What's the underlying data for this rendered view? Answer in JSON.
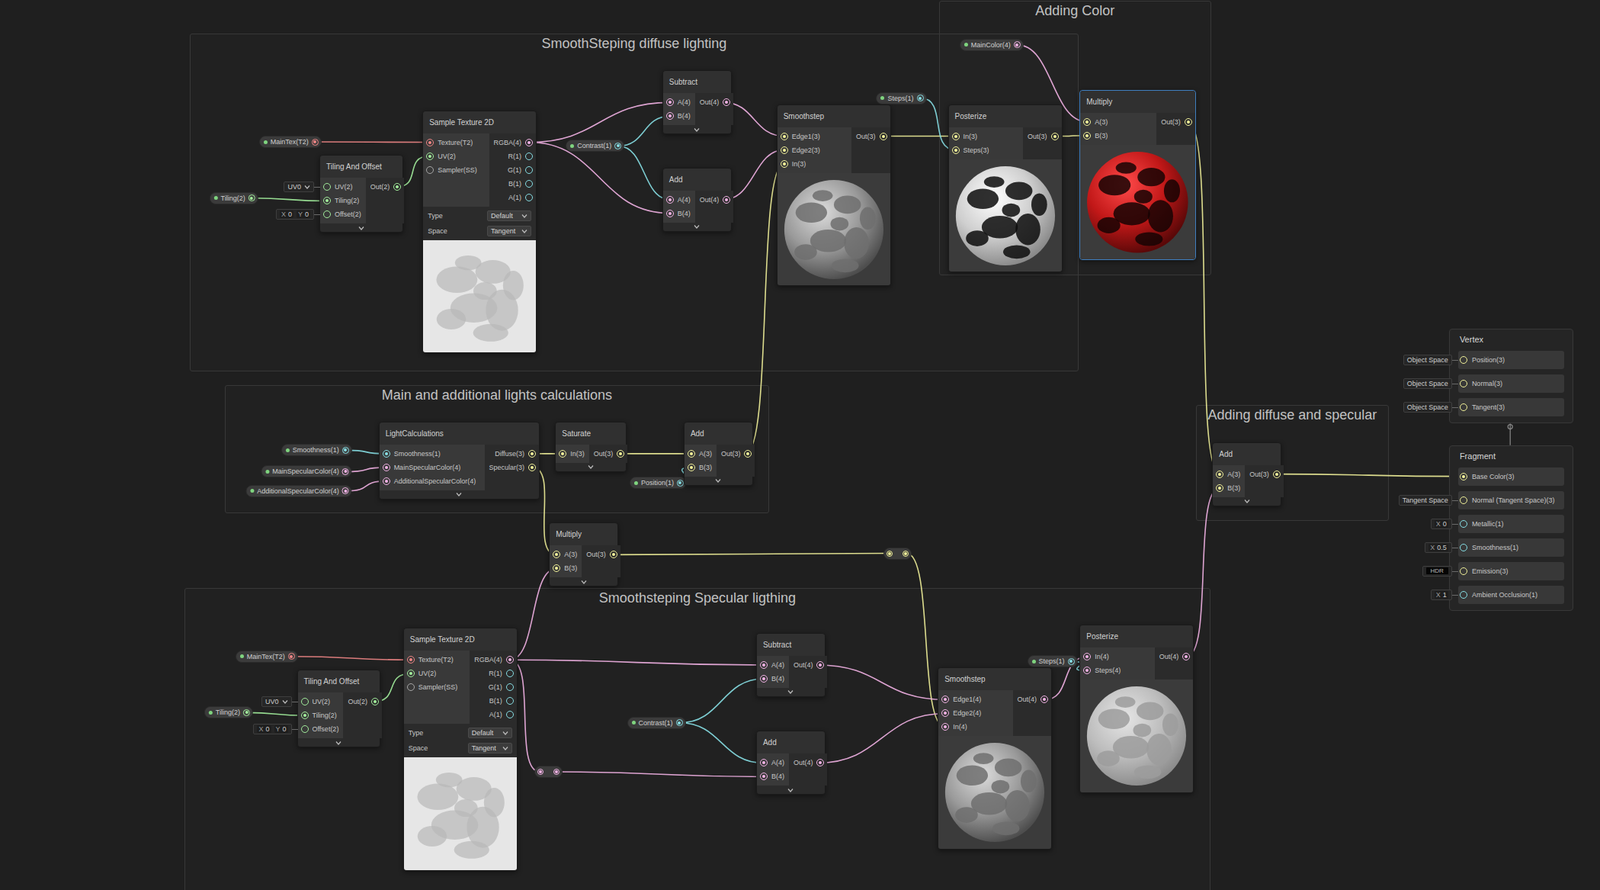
{
  "groups": [
    {
      "title": "SmoothSteping diffuse lighting"
    },
    {
      "title": "Adding Color"
    },
    {
      "title": "Main and additional lights calculations"
    },
    {
      "title": "Smoothsteping Specular ligthing"
    },
    {
      "title": "Adding diffuse and specular"
    }
  ],
  "properties": [
    {
      "label": "MainTex(T2)",
      "color": "#f08686"
    },
    {
      "label": "Tiling(2)",
      "color": "#a3ef9d"
    },
    {
      "label": "Contrast(1)",
      "color": "#87e0e6"
    },
    {
      "label": "Steps(1)",
      "color": "#87e0e6"
    },
    {
      "label": "MainColor(4)",
      "color": "#f3b3e6"
    },
    {
      "label": "Smoothness(1)",
      "color": "#87e0e6"
    },
    {
      "label": "MainSpecularColor(4)",
      "color": "#f3b3e6"
    },
    {
      "label": "AdditionalSpecularColor(4)",
      "color": "#f3b3e6"
    },
    {
      "label": "Position(1)",
      "color": "#87e0e6"
    },
    {
      "label": "MainTex(T2)",
      "color": "#f08686"
    },
    {
      "label": "Tiling(2)",
      "color": "#a3ef9d"
    },
    {
      "label": "Contrast(1)",
      "color": "#87e0e6"
    },
    {
      "label": "Steps(1)",
      "color": "#87e0e6"
    }
  ],
  "redirects": [
    {
      "color": "#f2f29a"
    },
    {
      "color": "#f3b3e6"
    }
  ],
  "nodes": [
    {
      "title": "Sample Texture 2D",
      "selected": false,
      "inputs": [
        {
          "label": "Texture(T2)",
          "color": "#f08686",
          "connected": true
        },
        {
          "label": "UV(2)",
          "color": "#a3ef9d",
          "connected": true
        },
        {
          "label": "Sampler(SS)",
          "color": "#a8a8a8",
          "connected": false
        }
      ],
      "outputs": [
        {
          "label": "RGBA(4)",
          "color": "#f3b3e6",
          "connected": true
        },
        {
          "label": "R(1)",
          "color": "#87e0e6",
          "connected": false
        },
        {
          "label": "G(1)",
          "color": "#87e0e6",
          "connected": false
        },
        {
          "label": "B(1)",
          "color": "#87e0e6",
          "connected": false
        },
        {
          "label": "A(1)",
          "color": "#87e0e6",
          "connected": false
        }
      ],
      "fields": [
        {
          "label": "Type",
          "value": "Default"
        },
        {
          "label": "Space",
          "value": "Tangent"
        }
      ],
      "preview": "texture"
    },
    {
      "title": "Tiling And Offset",
      "selected": false,
      "inputs": [
        {
          "label": "UV(2)",
          "color": "#a3ef9d",
          "connected": false,
          "default": {
            "kind": "dropdown",
            "value": "UV0"
          }
        },
        {
          "label": "Tiling(2)",
          "color": "#a3ef9d",
          "connected": true
        },
        {
          "label": "Offset(2)",
          "color": "#a3ef9d",
          "connected": false,
          "default": {
            "kind": "vector",
            "parts": [
              {
                "axis": "X",
                "value": "0"
              },
              {
                "axis": "Y",
                "value": "0"
              }
            ]
          }
        }
      ],
      "outputs": [
        {
          "label": "Out(2)",
          "color": "#a3ef9d",
          "connected": true
        }
      ]
    },
    {
      "title": "Subtract",
      "selected": false,
      "inputs": [
        {
          "label": "A(4)",
          "color": "#f3b3e6",
          "connected": true
        },
        {
          "label": "B(4)",
          "color": "#f3b3e6",
          "connected": true
        }
      ],
      "outputs": [
        {
          "label": "Out(4)",
          "color": "#f3b3e6",
          "connected": true
        }
      ]
    },
    {
      "title": "Add",
      "selected": false,
      "inputs": [
        {
          "label": "A(4)",
          "color": "#f3b3e6",
          "connected": true
        },
        {
          "label": "B(4)",
          "color": "#f3b3e6",
          "connected": true
        }
      ],
      "outputs": [
        {
          "label": "Out(4)",
          "color": "#f3b3e6",
          "connected": true
        }
      ]
    },
    {
      "title": "Smoothstep",
      "selected": false,
      "inputs": [
        {
          "label": "Edge1(3)",
          "color": "#f2f29a",
          "connected": true
        },
        {
          "label": "Edge2(3)",
          "color": "#f2f29a",
          "connected": true
        },
        {
          "label": "In(3)",
          "color": "#f2f29a",
          "connected": true
        }
      ],
      "outputs": [
        {
          "label": "Out(3)",
          "color": "#f2f29a",
          "connected": true
        }
      ],
      "preview": "grey"
    },
    {
      "title": "Posterize",
      "selected": false,
      "inputs": [
        {
          "label": "In(3)",
          "color": "#f2f29a",
          "connected": true
        },
        {
          "label": "Steps(3)",
          "color": "#f2f29a",
          "connected": true
        }
      ],
      "outputs": [
        {
          "label": "Out(3)",
          "color": "#f2f29a",
          "connected": true
        }
      ],
      "preview": "blackwhite"
    },
    {
      "title": "Multiply",
      "selected": true,
      "inputs": [
        {
          "label": "A(3)",
          "color": "#f2f29a",
          "connected": true
        },
        {
          "label": "B(3)",
          "color": "#f2f29a",
          "connected": true
        }
      ],
      "outputs": [
        {
          "label": "Out(3)",
          "color": "#f2f29a",
          "connected": true
        }
      ],
      "preview": "red"
    },
    {
      "title": "LightCalculations",
      "selected": false,
      "inputs": [
        {
          "label": "Smoothness(1)",
          "color": "#87e0e6",
          "connected": true
        },
        {
          "label": "MainSpecularColor(4)",
          "color": "#f3b3e6",
          "connected": true
        },
        {
          "label": "AdditionalSpecularColor(4)",
          "color": "#f3b3e6",
          "connected": true
        }
      ],
      "outputs": [
        {
          "label": "Diffuse(3)",
          "color": "#f2f29a",
          "connected": true
        },
        {
          "label": "Specular(3)",
          "color": "#f2f29a",
          "connected": true
        }
      ]
    },
    {
      "title": "Saturate",
      "selected": false,
      "inputs": [
        {
          "label": "In(3)",
          "color": "#f2f29a",
          "connected": true
        }
      ],
      "outputs": [
        {
          "label": "Out(3)",
          "color": "#f2f29a",
          "connected": true
        }
      ]
    },
    {
      "title": "Add",
      "selected": false,
      "inputs": [
        {
          "label": "A(3)",
          "color": "#f2f29a",
          "connected": true
        },
        {
          "label": "B(3)",
          "color": "#f2f29a",
          "connected": true
        }
      ],
      "outputs": [
        {
          "label": "Out(3)",
          "color": "#f2f29a",
          "connected": true
        }
      ]
    },
    {
      "title": "Multiply",
      "selected": false,
      "inputs": [
        {
          "label": "A(3)",
          "color": "#f2f29a",
          "connected": true
        },
        {
          "label": "B(3)",
          "color": "#f2f29a",
          "connected": true
        }
      ],
      "outputs": [
        {
          "label": "Out(3)",
          "color": "#f2f29a",
          "connected": true
        }
      ]
    },
    {
      "title": "Sample Texture 2D",
      "selected": false,
      "inputs": [
        {
          "label": "Texture(T2)",
          "color": "#f08686",
          "connected": true
        },
        {
          "label": "UV(2)",
          "color": "#a3ef9d",
          "connected": true
        },
        {
          "label": "Sampler(SS)",
          "color": "#a8a8a8",
          "connected": false
        }
      ],
      "outputs": [
        {
          "label": "RGBA(4)",
          "color": "#f3b3e6",
          "connected": true
        },
        {
          "label": "R(1)",
          "color": "#87e0e6",
          "connected": false
        },
        {
          "label": "G(1)",
          "color": "#87e0e6",
          "connected": false
        },
        {
          "label": "B(1)",
          "color": "#87e0e6",
          "connected": false
        },
        {
          "label": "A(1)",
          "color": "#87e0e6",
          "connected": false
        }
      ],
      "fields": [
        {
          "label": "Type",
          "value": "Default"
        },
        {
          "label": "Space",
          "value": "Tangent"
        }
      ],
      "preview": "texture"
    },
    {
      "title": "Tiling And Offset",
      "selected": false,
      "inputs": [
        {
          "label": "UV(2)",
          "color": "#a3ef9d",
          "connected": false,
          "default": {
            "kind": "dropdown",
            "value": "UV0"
          }
        },
        {
          "label": "Tiling(2)",
          "color": "#a3ef9d",
          "connected": true
        },
        {
          "label": "Offset(2)",
          "color": "#a3ef9d",
          "connected": false,
          "default": {
            "kind": "vector",
            "parts": [
              {
                "axis": "X",
                "value": "0"
              },
              {
                "axis": "Y",
                "value": "0"
              }
            ]
          }
        }
      ],
      "outputs": [
        {
          "label": "Out(2)",
          "color": "#a3ef9d",
          "connected": true
        }
      ]
    },
    {
      "title": "Subtract",
      "selected": false,
      "inputs": [
        {
          "label": "A(4)",
          "color": "#f3b3e6",
          "connected": true
        },
        {
          "label": "B(4)",
          "color": "#f3b3e6",
          "connected": true
        }
      ],
      "outputs": [
        {
          "label": "Out(4)",
          "color": "#f3b3e6",
          "connected": true
        }
      ]
    },
    {
      "title": "Add",
      "selected": false,
      "inputs": [
        {
          "label": "A(4)",
          "color": "#f3b3e6",
          "connected": true
        },
        {
          "label": "B(4)",
          "color": "#f3b3e6",
          "connected": true
        }
      ],
      "outputs": [
        {
          "label": "Out(4)",
          "color": "#f3b3e6",
          "connected": true
        }
      ]
    },
    {
      "title": "Smoothstep",
      "selected": false,
      "inputs": [
        {
          "label": "Edge1(4)",
          "color": "#f3b3e6",
          "connected": true
        },
        {
          "label": "Edge2(4)",
          "color": "#f3b3e6",
          "connected": true
        },
        {
          "label": "In(4)",
          "color": "#f3b3e6",
          "connected": true
        }
      ],
      "outputs": [
        {
          "label": "Out(4)",
          "color": "#f3b3e6",
          "connected": true
        }
      ],
      "preview": "grey"
    },
    {
      "title": "Posterize",
      "selected": false,
      "inputs": [
        {
          "label": "In(4)",
          "color": "#f3b3e6",
          "connected": true
        },
        {
          "label": "Steps(4)",
          "color": "#f3b3e6",
          "connected": true
        }
      ],
      "outputs": [
        {
          "label": "Out(4)",
          "color": "#f3b3e6",
          "connected": true
        }
      ],
      "preview": "light"
    },
    {
      "title": "Add",
      "selected": false,
      "inputs": [
        {
          "label": "A(3)",
          "color": "#f2f29a",
          "connected": true
        },
        {
          "label": "B(3)",
          "color": "#f2f29a",
          "connected": true
        }
      ],
      "outputs": [
        {
          "label": "Out(3)",
          "color": "#f2f29a",
          "connected": true
        }
      ]
    }
  ],
  "stacks": [
    {
      "title": "Vertex",
      "blocks": [
        {
          "label": "Position(3)",
          "color": "#f2f29a",
          "connected": false,
          "default": {
            "kind": "label",
            "value": "Object Space"
          }
        },
        {
          "label": "Normal(3)",
          "color": "#f2f29a",
          "connected": false,
          "default": {
            "kind": "label",
            "value": "Object Space"
          }
        },
        {
          "label": "Tangent(3)",
          "color": "#f2f29a",
          "connected": false,
          "default": {
            "kind": "label",
            "value": "Object Space"
          }
        }
      ]
    },
    {
      "title": "Fragment",
      "blocks": [
        {
          "label": "Base Color(3)",
          "color": "#f2f29a",
          "connected": true
        },
        {
          "label": "Normal (Tangent Space)(3)",
          "color": "#f2f29a",
          "connected": false,
          "default": {
            "kind": "label",
            "value": "Tangent Space"
          }
        },
        {
          "label": "Metallic(1)",
          "color": "#87e0e6",
          "connected": false,
          "default": {
            "kind": "vector",
            "parts": [
              {
                "axis": "X",
                "value": "0"
              }
            ]
          }
        },
        {
          "label": "Smoothness(1)",
          "color": "#87e0e6",
          "connected": false,
          "default": {
            "kind": "vector",
            "parts": [
              {
                "axis": "X",
                "value": "0.5"
              }
            ]
          }
        },
        {
          "label": "Emission(3)",
          "color": "#f2f29a",
          "connected": false,
          "default": {
            "kind": "hdr",
            "value": "HDR"
          }
        },
        {
          "label": "Ambient Occlusion(1)",
          "color": "#87e0e6",
          "connected": false,
          "default": {
            "kind": "vector",
            "parts": [
              {
                "axis": "X",
                "value": "1"
              }
            ]
          }
        }
      ]
    }
  ]
}
